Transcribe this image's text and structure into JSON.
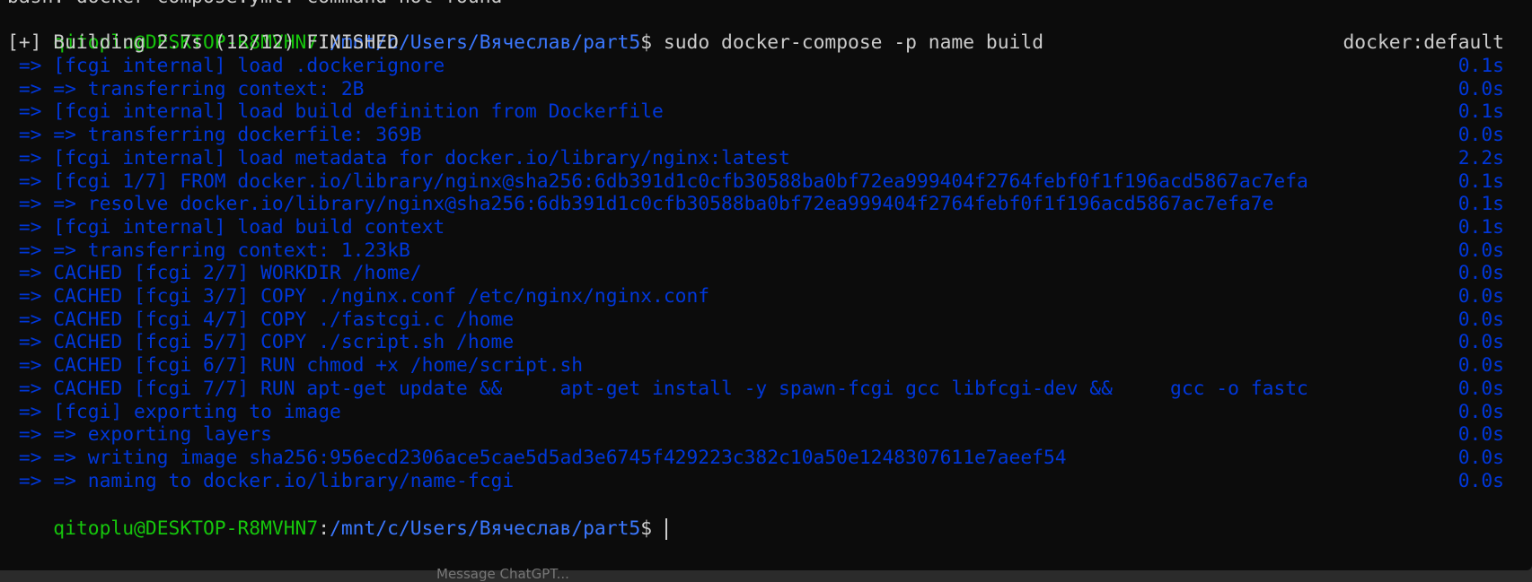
{
  "colors": {
    "background": "#0c0c0c",
    "prompt_user": "#16c60c",
    "prompt_path": "#3b78ff",
    "text": "#cccccc",
    "build_step": "#0037da"
  },
  "top_cut_line": "bash: docker-compose.yml: command not found",
  "prompt": {
    "user_host": "qitoplu@DESKTOP-R8MVHN7",
    "colon": ":",
    "path": "/mnt/c/Users/Вячеслав/part5",
    "symbol": "$ "
  },
  "command": "sudo docker-compose -p name build",
  "build_header": {
    "text": "[+] Building 2.7s (12/12) FINISHED",
    "context": "docker:default"
  },
  "steps": [
    {
      "text": " => [fcgi internal] load .dockerignore",
      "time": "0.1s"
    },
    {
      "text": " => => transferring context: 2B",
      "time": "0.0s"
    },
    {
      "text": " => [fcgi internal] load build definition from Dockerfile",
      "time": "0.1s"
    },
    {
      "text": " => => transferring dockerfile: 369B",
      "time": "0.0s"
    },
    {
      "text": " => [fcgi internal] load metadata for docker.io/library/nginx:latest",
      "time": "2.2s"
    },
    {
      "text": " => [fcgi 1/7] FROM docker.io/library/nginx@sha256:6db391d1c0cfb30588ba0bf72ea999404f2764febf0f1f196acd5867ac7efa",
      "time": "0.1s"
    },
    {
      "text": " => => resolve docker.io/library/nginx@sha256:6db391d1c0cfb30588ba0bf72ea999404f2764febf0f1f196acd5867ac7efa7e",
      "time": "0.1s"
    },
    {
      "text": " => [fcgi internal] load build context",
      "time": "0.1s"
    },
    {
      "text": " => => transferring context: 1.23kB",
      "time": "0.0s"
    },
    {
      "text": " => CACHED [fcgi 2/7] WORKDIR /home/",
      "time": "0.0s"
    },
    {
      "text": " => CACHED [fcgi 3/7] COPY ./nginx.conf /etc/nginx/nginx.conf",
      "time": "0.0s"
    },
    {
      "text": " => CACHED [fcgi 4/7] COPY ./fastcgi.c /home",
      "time": "0.0s"
    },
    {
      "text": " => CACHED [fcgi 5/7] COPY ./script.sh /home",
      "time": "0.0s"
    },
    {
      "text": " => CACHED [fcgi 6/7] RUN chmod +x /home/script.sh",
      "time": "0.0s"
    },
    {
      "text": " => CACHED [fcgi 7/7] RUN apt-get update &&     apt-get install -y spawn-fcgi gcc libfcgi-dev &&     gcc -o fastc",
      "time": "0.0s"
    },
    {
      "text": " => [fcgi] exporting to image",
      "time": "0.0s"
    },
    {
      "text": " => => exporting layers",
      "time": "0.0s"
    },
    {
      "text": " => => writing image sha256:956ecd2306ace5cae5d5ad3e6745f429223c382c10a50e1248307611e7aeef54",
      "time": "0.0s"
    },
    {
      "text": " => => naming to docker.io/library/name-fcgi",
      "time": "0.0s"
    }
  ],
  "background_window_text": "Message ChatGPT..."
}
